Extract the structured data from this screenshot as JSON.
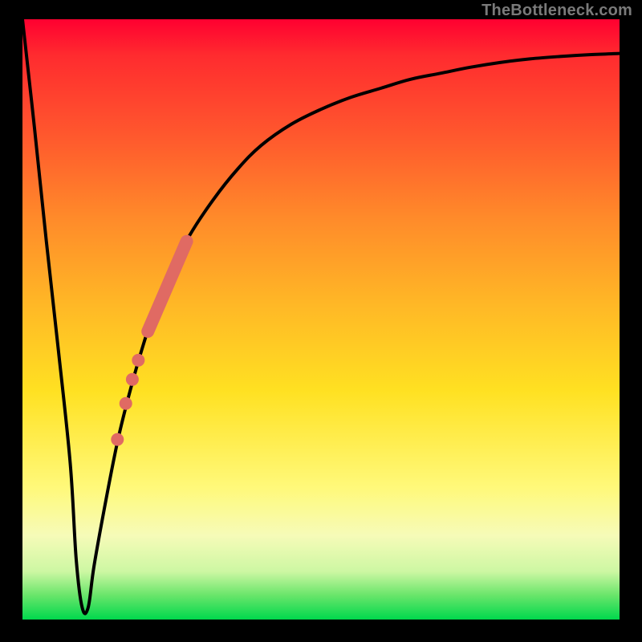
{
  "watermark": "TheBottleneck.com",
  "colors": {
    "curve": "#000000",
    "markers_fill": "#e06a63",
    "markers_stroke": "#c45650"
  },
  "chart_data": {
    "type": "line",
    "title": "",
    "xlabel": "",
    "ylabel": "",
    "xlim": [
      0,
      100
    ],
    "ylim": [
      0,
      100
    ],
    "grid": false,
    "series": [
      {
        "name": "bottleneck-curve",
        "x": [
          0,
          2,
          4,
          6,
          8,
          9,
          10,
          11,
          12,
          14,
          16,
          18,
          20,
          22,
          25,
          28,
          32,
          36,
          40,
          45,
          50,
          55,
          60,
          65,
          70,
          75,
          80,
          85,
          90,
          95,
          100
        ],
        "y": [
          100,
          82,
          63,
          45,
          26,
          10,
          2,
          2,
          9,
          20,
          30,
          38,
          45,
          51,
          58,
          64,
          70,
          75,
          79,
          82.5,
          85,
          87,
          88.5,
          90,
          91,
          92,
          92.8,
          93.4,
          93.8,
          94.1,
          94.3
        ]
      }
    ],
    "markers": {
      "name": "highlighted-range",
      "segment": {
        "x": [
          21,
          27.5
        ],
        "y": [
          48,
          63
        ]
      },
      "points": [
        {
          "x": 19.4,
          "y": 43.2
        },
        {
          "x": 18.4,
          "y": 40.0
        },
        {
          "x": 17.3,
          "y": 36.0
        },
        {
          "x": 15.9,
          "y": 30.0
        }
      ]
    }
  }
}
